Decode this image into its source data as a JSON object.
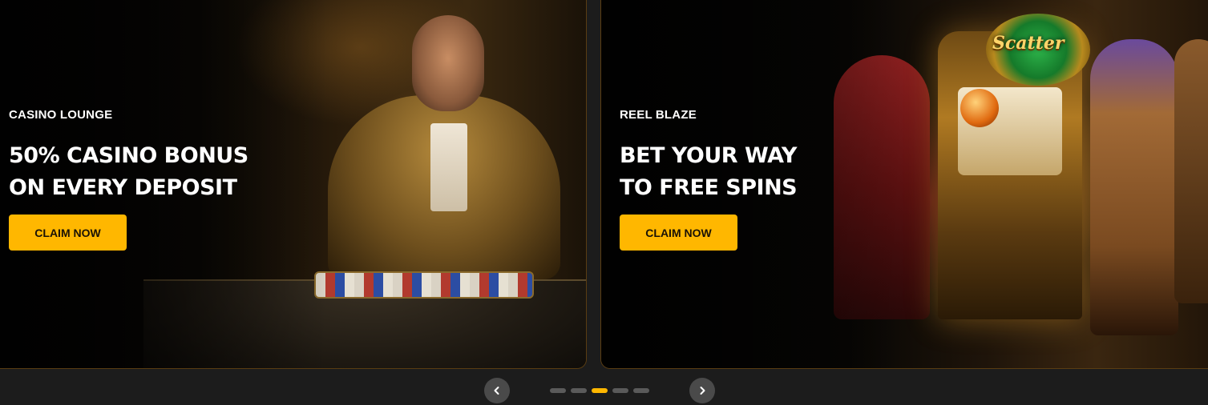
{
  "slides": [
    {
      "kicker": "CASINO LOUNGE",
      "headline_line1": "50% CASINO BONUS",
      "headline_line2": "ON EVERY DEPOSIT",
      "cta_label": "CLAIM NOW"
    },
    {
      "kicker": "REEL BLAZE",
      "headline_line1": "BET YOUR WAY",
      "headline_line2": "TO FREE SPINS",
      "cta_label": "CLAIM NOW",
      "artwork_badge": "Scatter"
    }
  ],
  "carousel": {
    "prev_icon": "chevron-left-icon",
    "next_icon": "chevron-right-icon",
    "dot_count": 5,
    "active_dot": 3
  },
  "colors": {
    "accent": "#ffb700",
    "background": "#1c1c1c",
    "dot_inactive": "#5a5a5a",
    "nav_button": "#4a4a4a"
  }
}
